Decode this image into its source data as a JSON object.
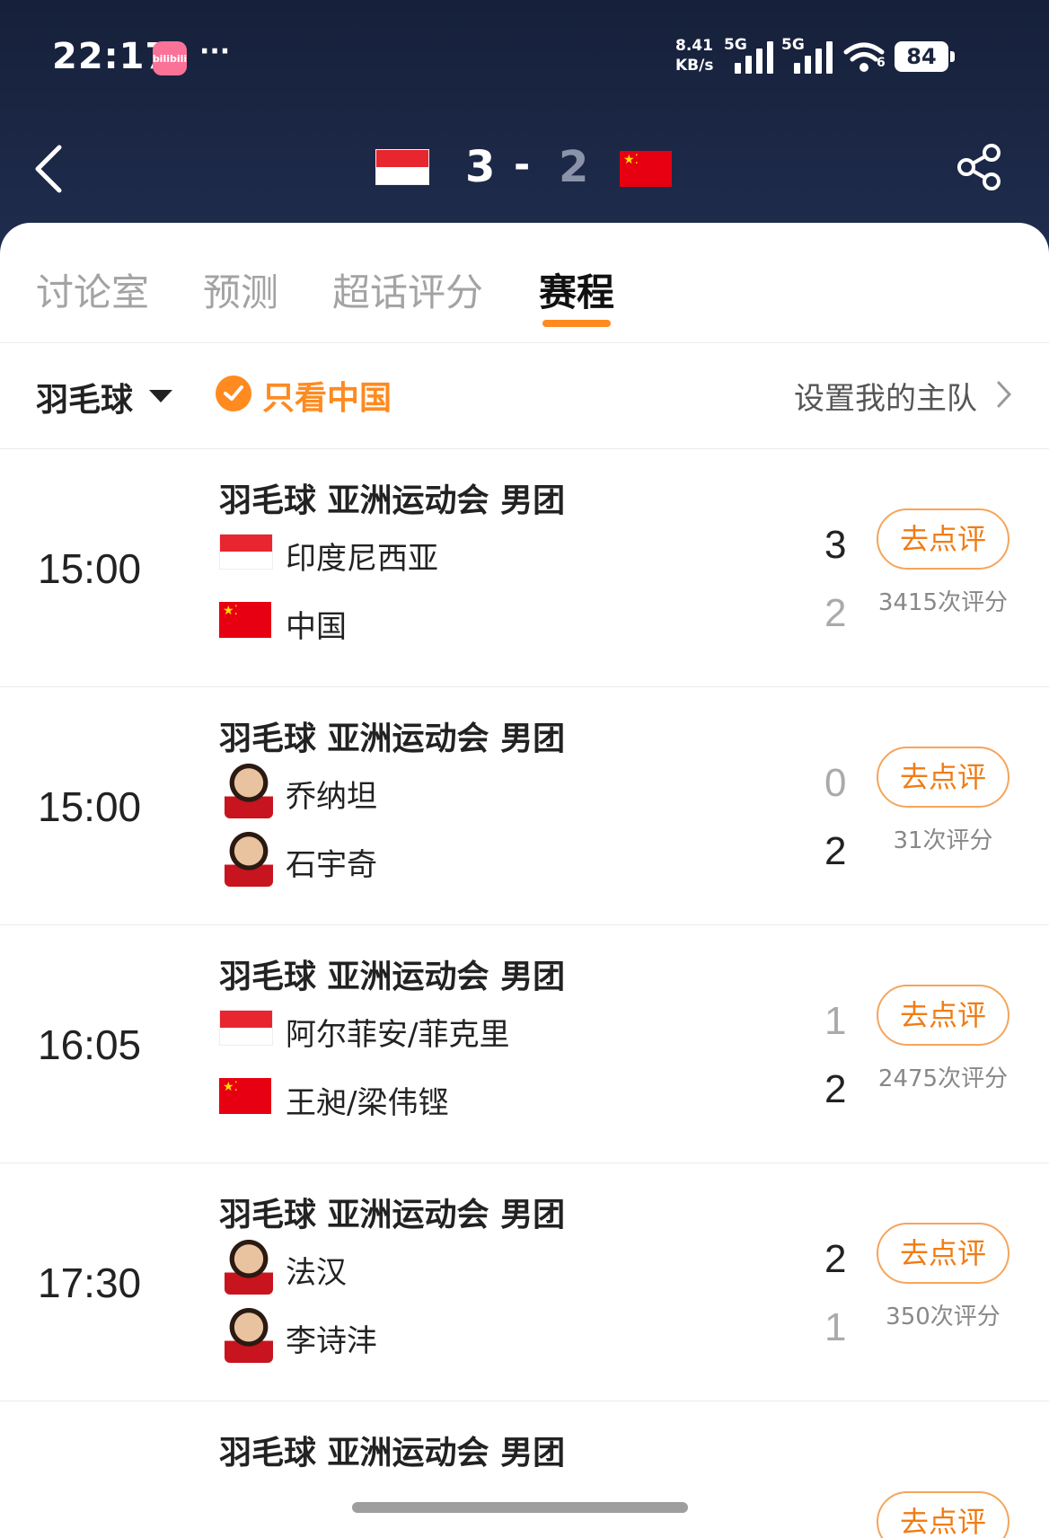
{
  "status_bar": {
    "time": "22:17",
    "app_badge": "bilibili",
    "more": "···",
    "net_speed_value": "8.41",
    "net_speed_unit": "KB/s",
    "signal1": "5G",
    "signal2": "5G",
    "wifi_sub": "6",
    "battery": "84"
  },
  "header": {
    "home_score": "3",
    "dash": "-",
    "away_score": "2"
  },
  "tabs": [
    {
      "label": "讨论室",
      "active": false
    },
    {
      "label": "预测",
      "active": false
    },
    {
      "label": "超话评分",
      "active": false
    },
    {
      "label": "赛程",
      "active": true
    }
  ],
  "filter": {
    "sport": "羽毛球",
    "only_china": "只看中国",
    "set_team": "设置我的主队"
  },
  "matches": [
    {
      "time": "15:00",
      "title": "羽毛球 亚洲运动会 男团",
      "home": {
        "name": "印度尼西亚",
        "score": "3"
      },
      "away": {
        "name": "中国",
        "score": "2"
      },
      "button": "去点评",
      "ratings": "3415次评分"
    },
    {
      "time": "15:00",
      "title": "羽毛球 亚洲运动会 男团",
      "home": {
        "name": "乔纳坦",
        "score": "0"
      },
      "away": {
        "name": "石宇奇",
        "score": "2"
      },
      "button": "去点评",
      "ratings": "31次评分"
    },
    {
      "time": "16:05",
      "title": "羽毛球 亚洲运动会 男团",
      "home": {
        "name": "阿尔菲安/菲克里",
        "score": "1"
      },
      "away": {
        "name": "王昶/梁伟铿",
        "score": "2"
      },
      "button": "去点评",
      "ratings": "2475次评分"
    },
    {
      "time": "17:30",
      "title": "羽毛球 亚洲运动会 男团",
      "home": {
        "name": "法汉",
        "score": "2"
      },
      "away": {
        "name": "李诗沣",
        "score": "1"
      },
      "button": "去点评",
      "ratings": "350次评分"
    },
    {
      "title": "羽毛球 亚洲运动会 男团",
      "button": "去点评"
    }
  ],
  "colors": {
    "accent": "#ff8a1f",
    "header_bg": "#1c2744",
    "indonesia_red": "#e7262f",
    "china_red": "#e60012"
  }
}
